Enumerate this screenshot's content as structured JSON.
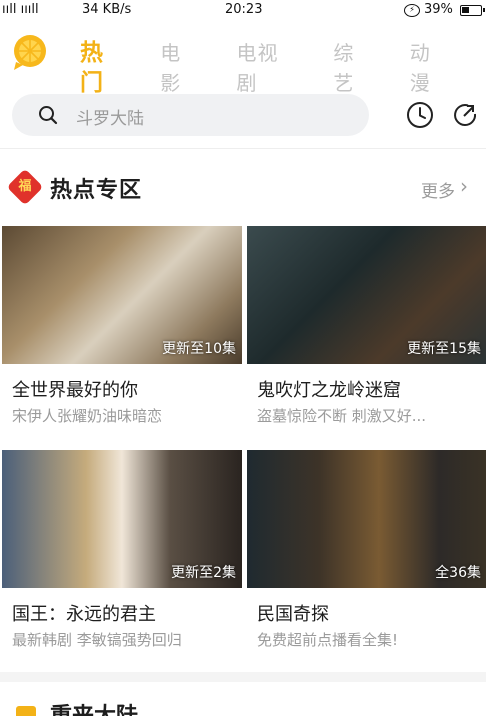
{
  "status": {
    "signal": "ııll ıııll",
    "speed": "34 KB/s",
    "time": "20:23",
    "battery_pct": "39%",
    "battery_level": 0.39
  },
  "nav": {
    "tabs": [
      {
        "label": "热门",
        "active": true
      },
      {
        "label": "电影",
        "active": false
      },
      {
        "label": "电视剧",
        "active": false
      },
      {
        "label": "综艺",
        "active": false
      },
      {
        "label": "动漫",
        "active": false
      }
    ]
  },
  "search": {
    "placeholder": "斗罗大陆"
  },
  "icons": {
    "logo": "orange-logo-icon",
    "search": "search-icon",
    "history": "clock-icon",
    "share": "share-icon",
    "section": "fu-badge-icon"
  },
  "section": {
    "icon_char": "福",
    "title": "热点专区",
    "more": "更多",
    "more_chevron": "›"
  },
  "cards": [
    {
      "badge": "更新至10集",
      "title": "全世界最好的你",
      "subtitle": "宋伊人张耀奶油味暗恋"
    },
    {
      "badge": "更新至15集",
      "title": "鬼吹灯之龙岭迷窟",
      "subtitle": "盗墓惊险不断 刺激又好..."
    },
    {
      "badge": "更新至2集",
      "title": "国王：永远的君主",
      "subtitle": "最新韩剧 李敏镐强势回归"
    },
    {
      "badge": "全36集",
      "title": "民国奇探",
      "subtitle": "免费超前点播看全集!"
    }
  ],
  "next_section": {
    "title": "重来大陆"
  },
  "colors": {
    "accent": "#f3b217",
    "badge_red": "#e0322b"
  }
}
